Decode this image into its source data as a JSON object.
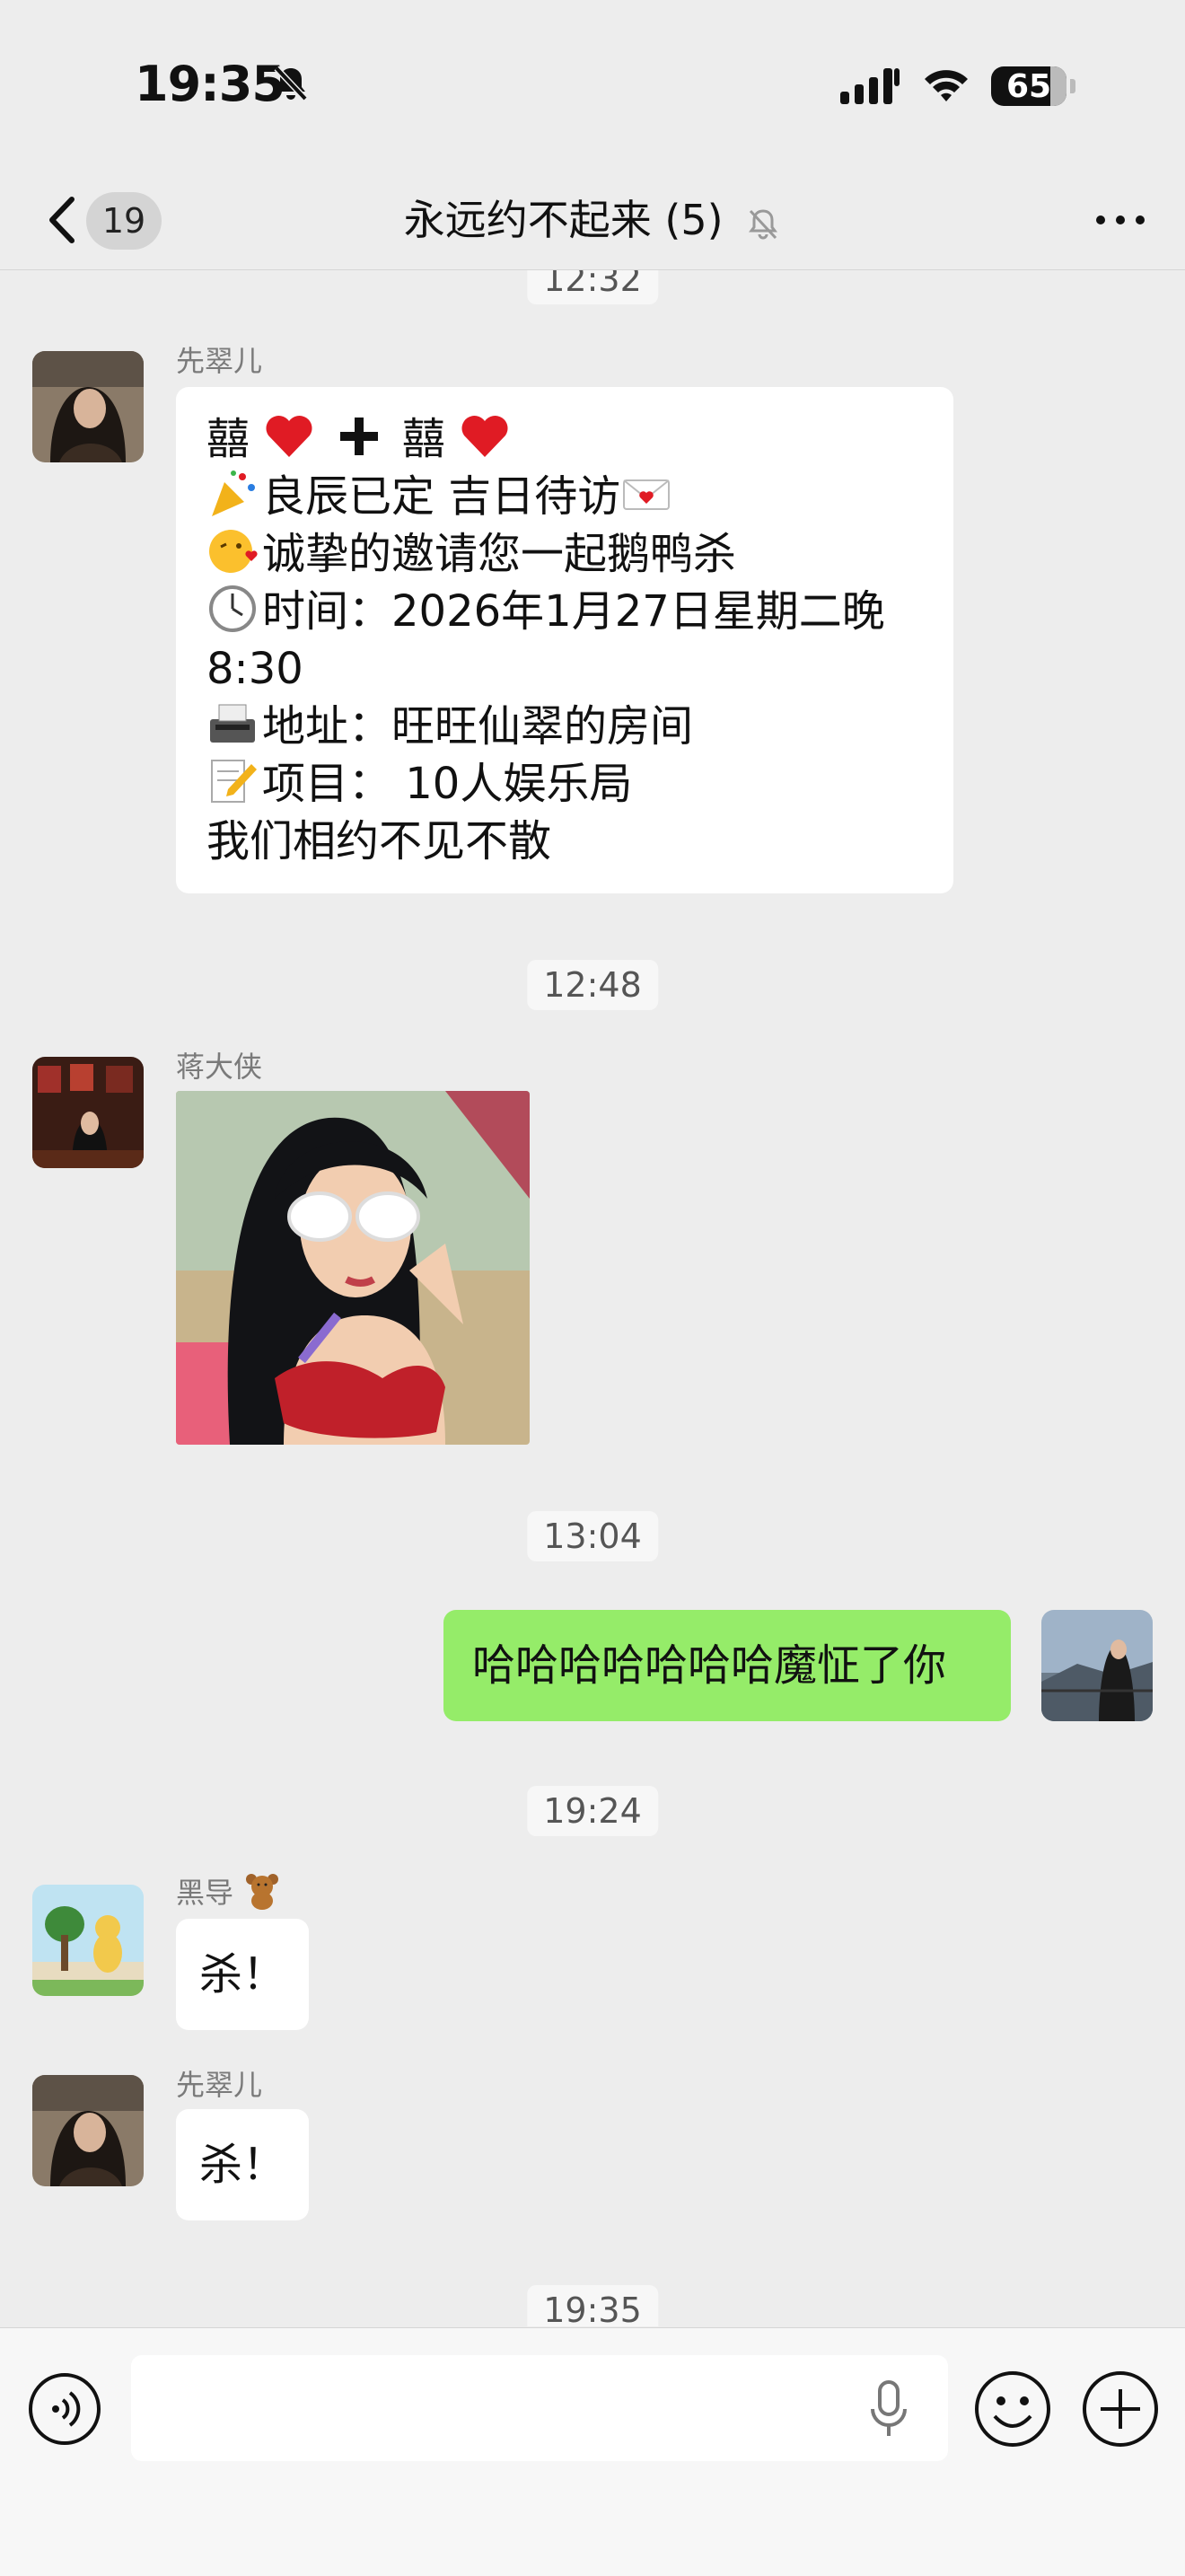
{
  "status_bar": {
    "time": "19:35",
    "battery": "65"
  },
  "nav": {
    "back_count": "19",
    "title": "永远约不起来 (5)"
  },
  "messages": {
    "ts1": "12:32",
    "m1": {
      "sender": "先翠儿",
      "line1_a": "囍",
      "line1_b": "囍",
      "line2": "良辰已定 吉日待访",
      "line3": "诚挚的邀请您一起鹅鸭杀",
      "line4": "时间：2026年1月27日星期二晚",
      "line5": "8:30",
      "line6": "地址：旺旺仙翠的房间",
      "line7": "项目： 10人娱乐局",
      "line8": "我们相约不见不散"
    },
    "ts2": "12:48",
    "m2": {
      "sender": "蒋大侠"
    },
    "ts3": "13:04",
    "m3": {
      "text": "哈哈哈哈哈哈哈魔怔了你"
    },
    "ts4": "19:24",
    "m4": {
      "sender": "黑导",
      "text": "杀！"
    },
    "m5": {
      "sender": "先翠儿",
      "text": "杀！"
    },
    "ts5": "19:35"
  },
  "icons": {
    "bell": "bell-off-icon",
    "signal": "cellular-signal-icon",
    "wifi": "wifi-icon",
    "back": "chevron-left-icon",
    "more": "more-icon",
    "voice": "voice-icon",
    "mic": "microphone-icon",
    "emoji": "emoji-icon",
    "plus": "plus-icon"
  },
  "colors": {
    "background": "#ededed",
    "my_bubble": "#95ec69",
    "their_bubble": "#ffffff"
  }
}
